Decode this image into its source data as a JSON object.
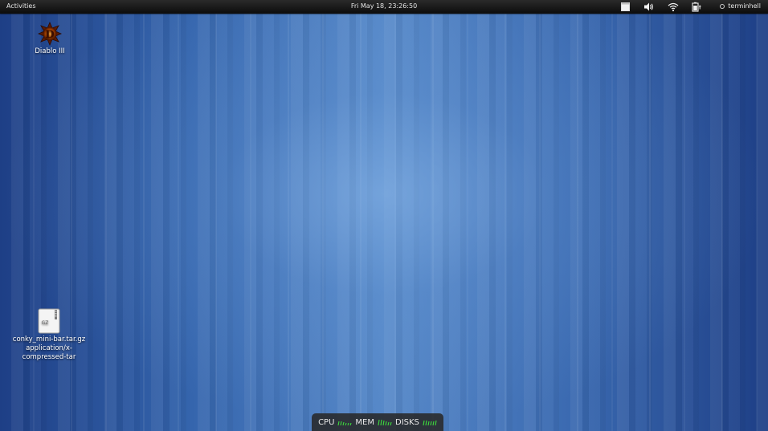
{
  "topbar": {
    "activities_label": "Activities",
    "clock": "Fri May 18, 23:26:50",
    "username": "terminhell",
    "tray": [
      "window-icon",
      "volume-icon",
      "wifi-icon",
      "battery-icon"
    ]
  },
  "desktop_icons": [
    {
      "label": "Diablo III",
      "icon": "diablo-icon"
    },
    {
      "label": "conky_mini-bar.tar.gz application/x-compressed-tar",
      "icon": "gz-archive-icon",
      "badge": "GZ"
    }
  ],
  "conky": {
    "cpu_label": "CPU",
    "mem_label": "MEM",
    "disks_label": "DISKS",
    "meter_color": "#3ddc3d"
  },
  "colors": {
    "wallpaper_base": "#3565ad",
    "topbar": "#111111"
  }
}
